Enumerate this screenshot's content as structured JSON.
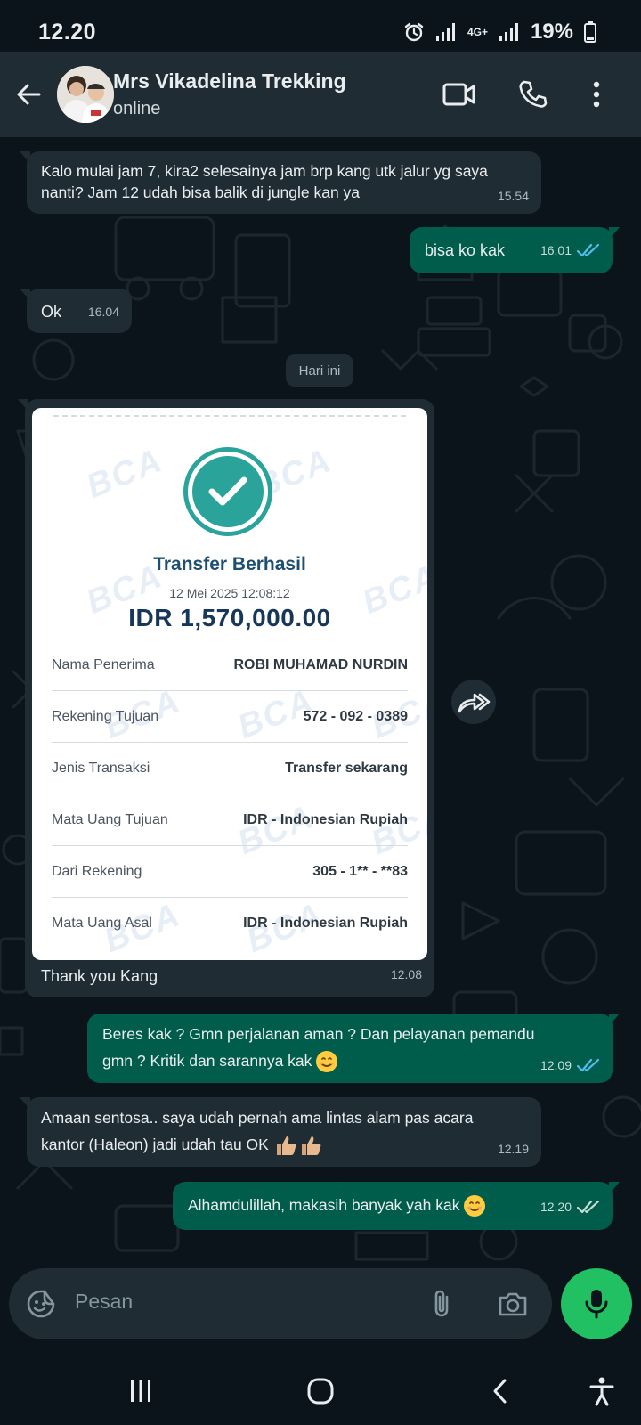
{
  "status_bar": {
    "time": "12.20",
    "network": "4G+",
    "battery": "19%"
  },
  "header": {
    "contact_name": "Mrs Vikadelina Trekking",
    "status": "online",
    "icons": [
      "back-arrow-icon",
      "video-call-icon",
      "phone-icon",
      "more-vert-icon"
    ]
  },
  "date_chip": "Hari ini",
  "messages": [
    {
      "dir": "in",
      "text": "Kalo mulai jam 7, kira2 selesainya jam brp kang utk jalur yg saya\nnanti? Jam 12 udah bisa balik di jungle kan ya",
      "time": "15.54"
    },
    {
      "dir": "out",
      "text": "bisa ko kak",
      "time": "16.01",
      "ticks": "read"
    },
    {
      "dir": "in",
      "text": "Ok",
      "time": "16.04"
    },
    {
      "dir": "in",
      "type": "image",
      "caption": "Thank you Kang",
      "time": "12.08"
    },
    {
      "dir": "out",
      "text": "Beres kak ? Gmn perjalanan aman ? Dan pelayanan pemandu\ngmn ? Kritik dan sarannya kak",
      "emoji": "smiling-face",
      "time": "12.09",
      "ticks": "read"
    },
    {
      "dir": "in",
      "text": "Amaan sentosa.. saya udah pernah ama lintas alam pas acara\nkantor (Haleon) jadi udah tau OK",
      "emoji": "thumbs-up-x2",
      "time": "12.19"
    },
    {
      "dir": "out",
      "text": "Alhamdulillah, makasih banyak yah kak",
      "emoji": "smiling-face",
      "time": "12.20",
      "ticks": "delivered"
    }
  ],
  "receipt": {
    "watermark": "BCA",
    "title": "Transfer Berhasil",
    "datetime": "12 Mei 2025 12:08:12",
    "amount": "IDR 1,570,000.00",
    "rows": [
      {
        "label": "Nama Penerima",
        "value": "ROBI MUHAMAD NURDIN"
      },
      {
        "label": "Rekening Tujuan",
        "value": "572 - 092 - 0389"
      },
      {
        "label": "Jenis Transaksi",
        "value": "Transfer sekarang"
      },
      {
        "label": "Mata Uang Tujuan",
        "value": "IDR - Indonesian Rupiah"
      },
      {
        "label": "Dari Rekening",
        "value": "305 - 1** - **83"
      },
      {
        "label": "Mata Uang Asal",
        "value": "IDR - Indonesian Rupiah"
      }
    ]
  },
  "input": {
    "placeholder": "Pesan"
  },
  "colors": {
    "background": "#0b141a",
    "header": "#1f2c34",
    "incoming_bubble": "#1f2c34",
    "outgoing_bubble": "#005c4b",
    "accent_green": "#21c063",
    "read_tick": "#53bdeb",
    "receipt_check": "#2aa39b"
  }
}
